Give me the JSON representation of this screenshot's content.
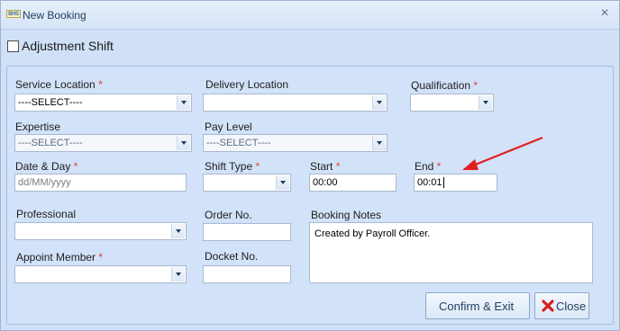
{
  "window": {
    "title": "New Booking",
    "app_icon_text": "BHS",
    "close_glyph": "×"
  },
  "adjustment_shift": {
    "label": "Adjustment Shift",
    "checked": false
  },
  "form": {
    "service_location": {
      "label": "Service Location",
      "required": "*",
      "value": "----SELECT----"
    },
    "delivery_location": {
      "label": "Delivery Location",
      "value": ""
    },
    "qualification": {
      "label": "Qualification",
      "required": "*",
      "value": ""
    },
    "expertise": {
      "label": "Expertise",
      "value": "----SELECT----"
    },
    "pay_level": {
      "label": "Pay Level",
      "value": "----SELECT----"
    },
    "date_day": {
      "label": "Date & Day",
      "required": "*",
      "placeholder": "dd/MM/yyyy"
    },
    "shift_type": {
      "label": "Shift Type",
      "required": "*",
      "value": ""
    },
    "start": {
      "label": "Start",
      "required": "*",
      "value": "00:00"
    },
    "end": {
      "label": "End",
      "required": "*",
      "value": "00:01"
    },
    "professional": {
      "label": "Professional",
      "value": ""
    },
    "order_no": {
      "label": "Order No.",
      "value": ""
    },
    "booking_notes": {
      "label": "Booking Notes",
      "value": "Created by Payroll Officer."
    },
    "appoint_member": {
      "label": "Appoint Member",
      "required": "*",
      "value": ""
    },
    "docket_no": {
      "label": "Docket No.",
      "value": ""
    }
  },
  "buttons": {
    "confirm_exit": "Confirm & Exit",
    "close": "Close"
  },
  "annotation": {
    "color": "#e02020",
    "icon": "red-arrow-icon"
  }
}
